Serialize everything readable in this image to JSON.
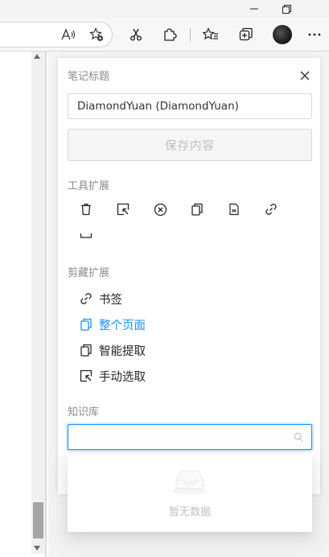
{
  "panel": {
    "header": "笔记标题",
    "note_title_value": "DiamondYuan (DiamondYuan)",
    "save_label": "保存内容",
    "tools_label": "工具扩展",
    "clip_label": "剪藏扩展",
    "clip_items": [
      {
        "label": "书签",
        "icon": "link-icon"
      },
      {
        "label": "整个页面",
        "icon": "copy-icon"
      },
      {
        "label": "智能提取",
        "icon": "copy-icon"
      },
      {
        "label": "手动选取",
        "icon": "select-area-icon"
      }
    ],
    "kb_label": "知识库",
    "kb_value": "",
    "empty_text": "暂无数据"
  },
  "colors": {
    "accent": "#1890ff",
    "muted": "#8c8c8c",
    "disabled": "#bfbfbf"
  }
}
